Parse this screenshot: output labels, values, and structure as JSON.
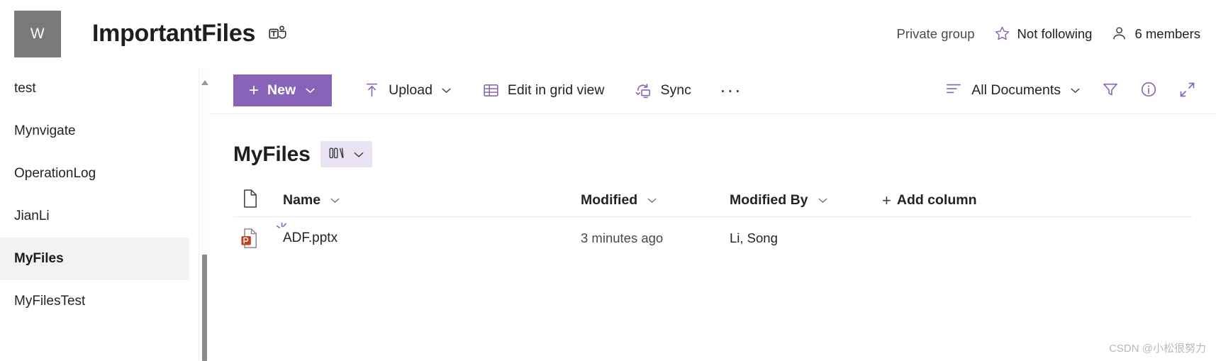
{
  "header": {
    "logo_initial": "W",
    "site_title": "ImportantFiles",
    "teams_icon": "teams-icon",
    "privacy_label": "Private group",
    "follow_label": "Not following",
    "follow_icon": "star-icon",
    "members_label": "6 members",
    "members_icon": "person-icon"
  },
  "sidebar": {
    "items": [
      {
        "label": "test",
        "selected": false
      },
      {
        "label": "Mynvigate",
        "selected": false
      },
      {
        "label": "OperationLog",
        "selected": false
      },
      {
        "label": "JianLi",
        "selected": false
      },
      {
        "label": "MyFiles",
        "selected": true
      },
      {
        "label": "MyFilesTest",
        "selected": false
      }
    ]
  },
  "toolbar": {
    "new_label": "New",
    "new_icon": "plus-icon",
    "new_chevron": "chevron-down-icon",
    "new_bg_color": "#8764b8",
    "upload_label": "Upload",
    "upload_icon": "upload-icon",
    "upload_chevron": "chevron-down-icon",
    "grid_label": "Edit in grid view",
    "grid_icon": "table-icon",
    "sync_label": "Sync",
    "sync_icon": "sync-icon",
    "more_label": "···",
    "more_icon": "ellipsis-icon",
    "view_label": "All Documents",
    "view_icon": "list-lines-icon",
    "view_chevron": "chevron-down-icon",
    "filter_icon": "filter-funnel-icon",
    "info_icon": "info-circle-icon",
    "expand_icon": "expand-diagonal-icon",
    "accent_color": "#8764b8"
  },
  "list": {
    "title": "MyFiles",
    "view_switcher_icon": "columns-view-icon",
    "view_switcher_chevron": "chevron-down-icon",
    "view_pill_bg": "#e9e2f3",
    "columns": [
      {
        "label": "",
        "icon": "file-type-icon",
        "sortable": true
      },
      {
        "label": "Name",
        "sortable": true
      },
      {
        "label": "Modified",
        "sortable": true
      },
      {
        "label": "Modified By",
        "sortable": true
      }
    ],
    "add_column_label": "Add column",
    "add_column_icon": "plus-icon",
    "rows": [
      {
        "file_icon": "powerpoint-icon",
        "name": "ADF.pptx",
        "is_new": true,
        "modified": "3 minutes ago",
        "modified_by": "Li, Song"
      }
    ]
  },
  "scrollbar": {
    "up_arrow_icon": "scroll-up-arrow-icon",
    "thumb": "scroll-thumb"
  },
  "watermark": {
    "text": "CSDN @小松很努力"
  }
}
